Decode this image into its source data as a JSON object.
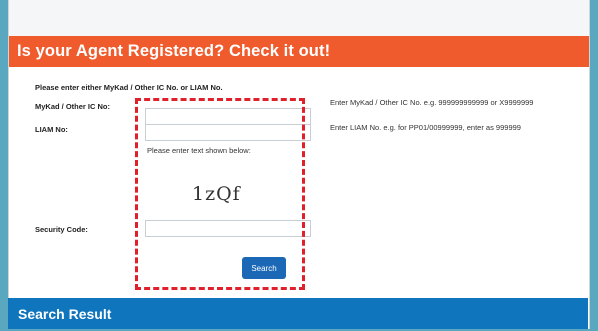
{
  "header": {
    "title": "Is your Agent Registered? Check it out!"
  },
  "form": {
    "intro": "Please enter either MyKad / Other IC No. or LIAM No.",
    "mykad_label": "MyKad / Other IC No:",
    "mykad_value": "",
    "mykad_hint": "Enter MyKad / Other IC No. e.g. 999999999999 or X9999999",
    "liam_label": "LIAM No:",
    "liam_value": "",
    "liam_hint": "Enter LIAM No. e.g. for PP01/00999999, enter as 999999",
    "captcha_prompt": "Please enter text shown below:",
    "captcha_text": "1zQf",
    "security_label": "Security Code:",
    "security_value": "",
    "search_label": "Search"
  },
  "results": {
    "title": "Search Result"
  },
  "colors": {
    "header": "#ef5b2c",
    "result_bar": "#0f75bd",
    "button": "#1b68b6",
    "highlight": "#e0212b",
    "frame": "#5aa8bf"
  }
}
